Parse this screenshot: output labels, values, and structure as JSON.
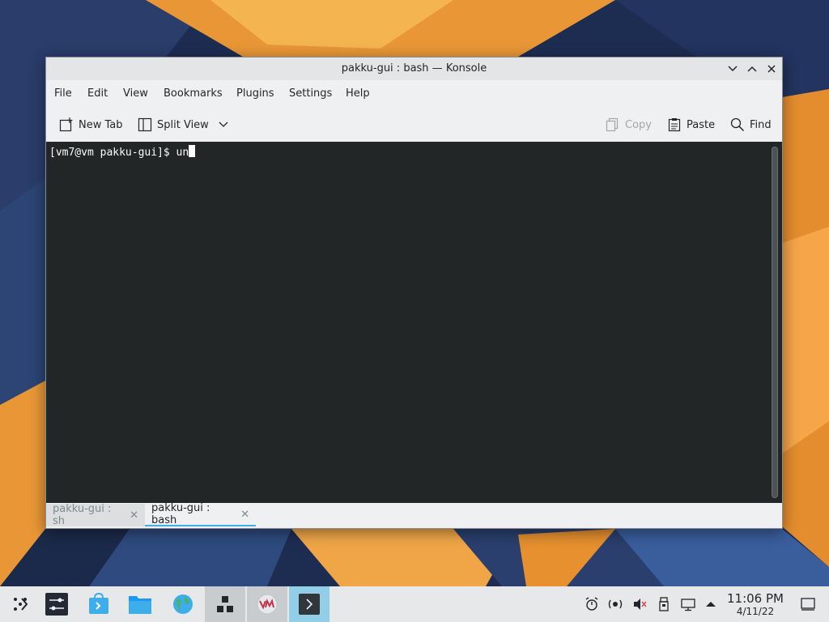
{
  "window": {
    "title": "pakku-gui : bash — Konsole"
  },
  "menu": {
    "items": [
      "File",
      "Edit",
      "View",
      "Bookmarks",
      "Plugins",
      "Settings",
      "Help"
    ]
  },
  "toolbar": {
    "new_tab": "New Tab",
    "split_view": "Split View",
    "copy": "Copy",
    "paste": "Paste",
    "find": "Find"
  },
  "terminal": {
    "prompt": "[vm7@vm pakku-gui]$ un"
  },
  "tabs": [
    {
      "label": "pakku-gui : sh",
      "active": false
    },
    {
      "label": "pakku-gui : bash",
      "active": true
    }
  ],
  "taskbar": {
    "time": "11:06 PM",
    "date": "4/11/22"
  },
  "colors": {
    "accent": "#3daee9",
    "terminal_bg": "#232627",
    "terminal_fg": "#fcfcfc"
  }
}
